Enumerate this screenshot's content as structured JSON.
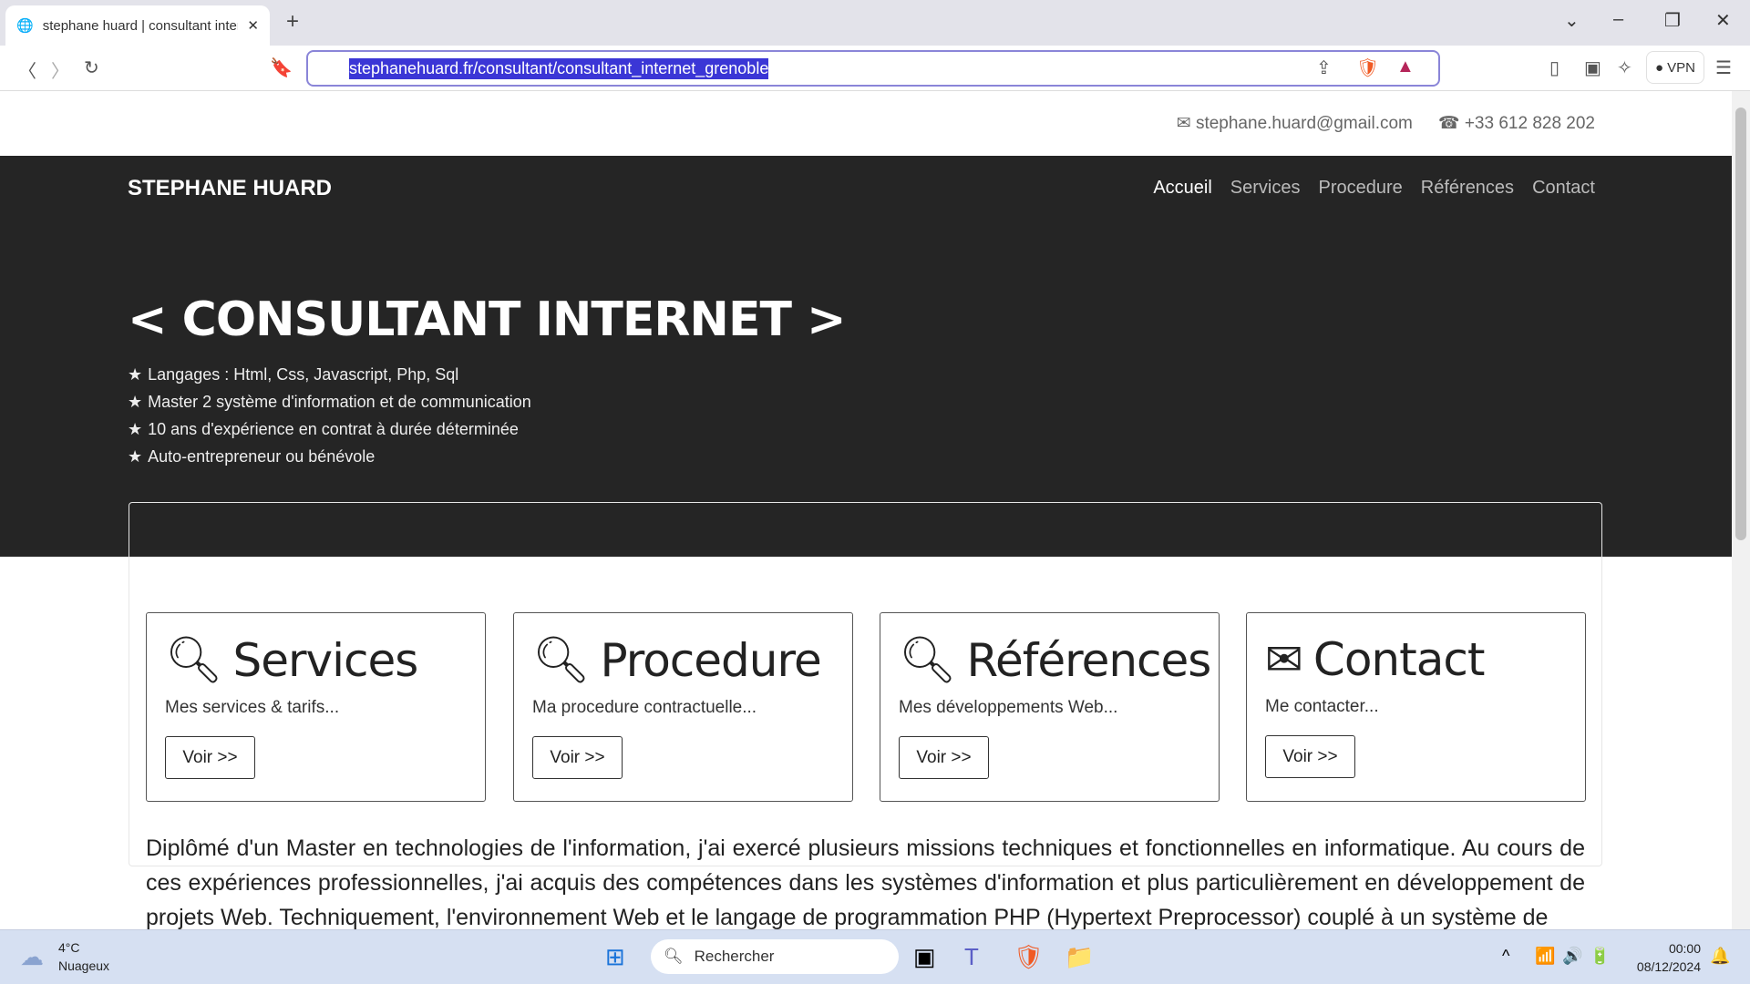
{
  "browser": {
    "tab_title": "stephane huard | consultant internet",
    "url": "stephanehuard.fr/consultant/consultant_internet_grenoble",
    "vpn_label": "VPN"
  },
  "contact": {
    "email": "stephane.huard@gmail.com",
    "phone": "+33 612 828 202"
  },
  "site": {
    "brand": "STEPHANE HUARD",
    "nav": [
      "Accueil",
      "Services",
      "Procedure",
      "Références",
      "Contact"
    ],
    "hero_title": "< CONSULTANT INTERNET >",
    "hero_items": [
      "Langages : Html, Css, Javascript, Php, Sql",
      "Master 2 système d'information et de communication",
      "10 ans d'expérience en contrat à durée déterminée",
      "Auto-entrepreneur ou bénévole"
    ],
    "cards": [
      {
        "icon": "search-icon",
        "title": "Services",
        "text": "Mes services & tarifs...",
        "button": "Voir >>"
      },
      {
        "icon": "search-icon",
        "title": "Procedure",
        "text": "Ma procedure contractuelle...",
        "button": "Voir >>"
      },
      {
        "icon": "search-icon",
        "title": "Références",
        "text": "Mes développements Web...",
        "button": "Voir >>"
      },
      {
        "icon": "envelope-icon",
        "title": "Contact",
        "text": "Me contacter...",
        "button": "Voir >>"
      }
    ],
    "paragraph": "Diplômé d'un Master en technologies de l'information, j'ai exercé plusieurs missions techniques et fonctionnelles en informatique. Au cours de ces expériences professionnelles, j'ai acquis des compétences dans les systèmes d'information et plus particulièrement en développement de projets Web. Techniquement, l'environnement Web et le langage de programmation PHP (Hypertext Preprocessor) couplé à un système de"
  },
  "taskbar": {
    "temp": "4°C",
    "weather": "Nuageux",
    "search_placeholder": "Rechercher",
    "time": "00:00",
    "date": "08/12/2024"
  }
}
